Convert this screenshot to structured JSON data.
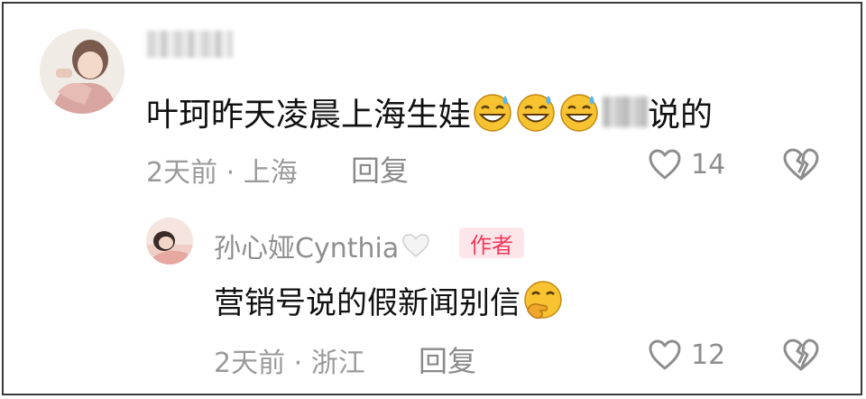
{
  "comments": [
    {
      "text_before": "叶珂昨天凌晨上海生娃",
      "text_after": "说的",
      "meta": "2天前 · 上海",
      "reply_label": "回复",
      "likes": "14",
      "emoji_name": "grinning-sweat-emoji"
    }
  ],
  "reply": {
    "username": "孙心娅Cynthia",
    "author_badge": "作者",
    "text": "营销号说的假新闻别信",
    "meta": "2天前 · 浙江",
    "reply_label": "回复",
    "likes": "12",
    "emoji_name": "hand-over-mouth-emoji"
  },
  "colors": {
    "text": "#111111",
    "meta": "#9a9a9a",
    "badge_bg": "#fde6ea",
    "badge_text": "#f23a5c",
    "icon": "#8d8d8d",
    "frame": "#3a3a3a"
  }
}
